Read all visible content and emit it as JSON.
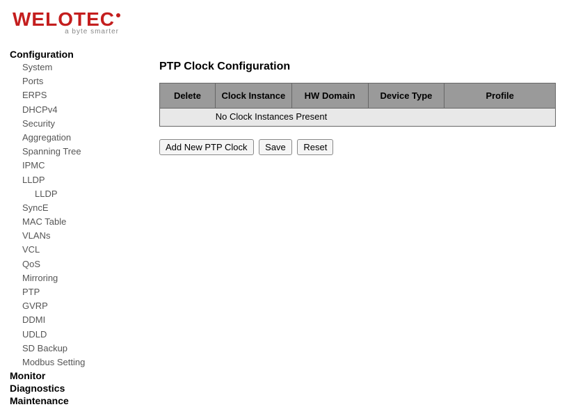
{
  "logo": {
    "text": "WELOTEC",
    "tagline": "a byte smarter"
  },
  "sidebar": {
    "sections": [
      {
        "title": "Configuration",
        "items": [
          {
            "label": "System"
          },
          {
            "label": "Ports"
          },
          {
            "label": "ERPS"
          },
          {
            "label": "DHCPv4"
          },
          {
            "label": "Security"
          },
          {
            "label": "Aggregation"
          },
          {
            "label": "Spanning Tree"
          },
          {
            "label": "IPMC"
          },
          {
            "label": "LLDP",
            "children": [
              {
                "label": "LLDP"
              }
            ]
          },
          {
            "label": "SyncE"
          },
          {
            "label": "MAC Table"
          },
          {
            "label": "VLANs"
          },
          {
            "label": "VCL"
          },
          {
            "label": "QoS"
          },
          {
            "label": "Mirroring"
          },
          {
            "label": "PTP"
          },
          {
            "label": "GVRP"
          },
          {
            "label": "DDMI"
          },
          {
            "label": "UDLD"
          },
          {
            "label": "SD Backup"
          },
          {
            "label": "Modbus Setting"
          }
        ]
      },
      {
        "title": "Monitor",
        "items": []
      },
      {
        "title": "Diagnostics",
        "items": []
      },
      {
        "title": "Maintenance",
        "items": []
      }
    ]
  },
  "main": {
    "title": "PTP Clock Configuration",
    "table": {
      "headers": [
        "Delete",
        "Clock Instance",
        "HW Domain",
        "Device Type",
        "Profile"
      ],
      "empty_message": "No Clock Instances Present"
    },
    "buttons": {
      "add": "Add New PTP Clock",
      "save": "Save",
      "reset": "Reset"
    }
  }
}
